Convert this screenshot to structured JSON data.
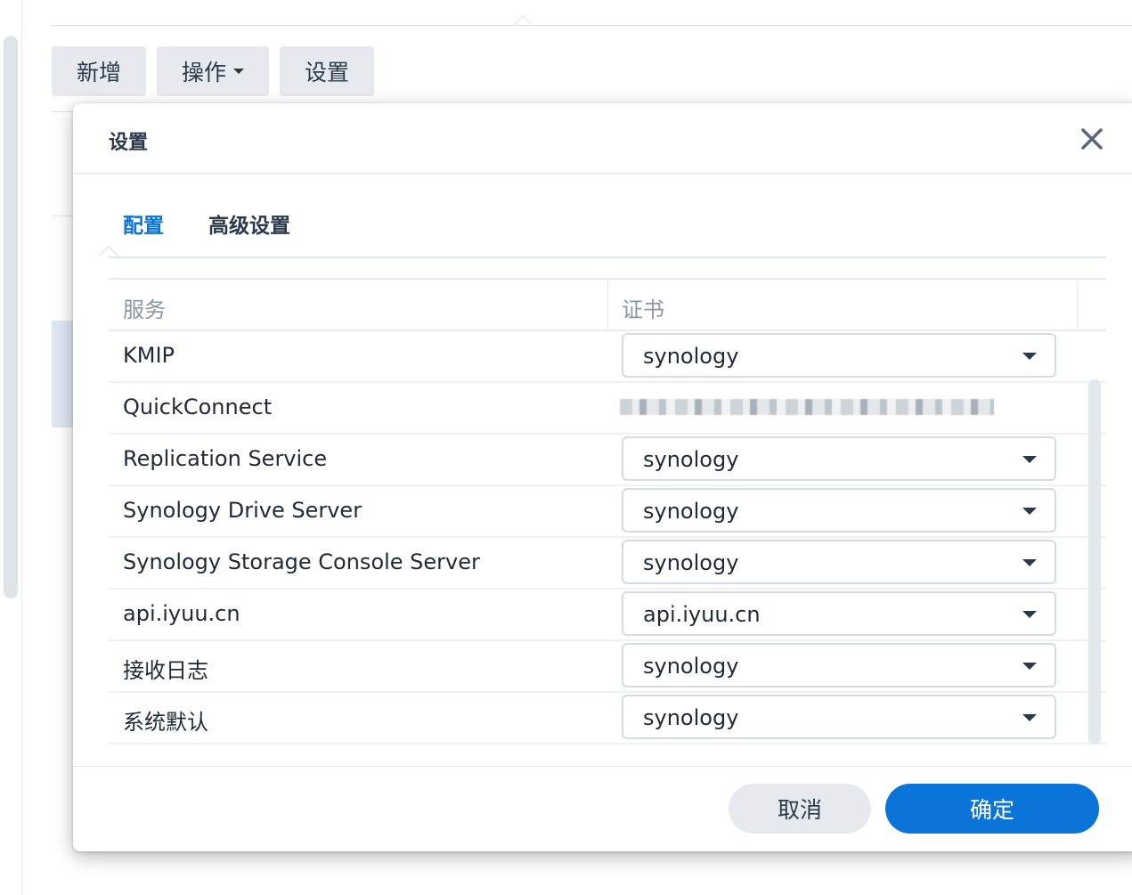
{
  "toolbar": {
    "add_label": "新增",
    "action_label": "操作",
    "settings_label": "设置"
  },
  "dialog": {
    "title": "设置",
    "close_icon": "close-icon",
    "tabs": [
      {
        "label": "配置",
        "active": true
      },
      {
        "label": "高级设置",
        "active": false
      }
    ],
    "table": {
      "headers": {
        "service": "服务",
        "certificate": "证书"
      },
      "rows": [
        {
          "service": "KMIP",
          "certificate": "synology"
        },
        {
          "service": "QuickConnect",
          "certificate": ""
        },
        {
          "service": "Replication Service",
          "certificate": "synology"
        },
        {
          "service": "Synology Drive Server",
          "certificate": "synology"
        },
        {
          "service": "Synology Storage Console Server",
          "certificate": "synology"
        },
        {
          "service": "api.iyuu.cn",
          "certificate": "api.iyuu.cn"
        },
        {
          "service": "接收日志",
          "certificate": "synology"
        },
        {
          "service": "系统默认",
          "certificate": "synology"
        }
      ]
    },
    "cancel_label": "取消",
    "ok_label": "确定"
  },
  "colors": {
    "accent": "#0a74d9",
    "button_gray": "#e6eaef",
    "text": "#1e2a38",
    "header_text": "#8a96a3"
  }
}
